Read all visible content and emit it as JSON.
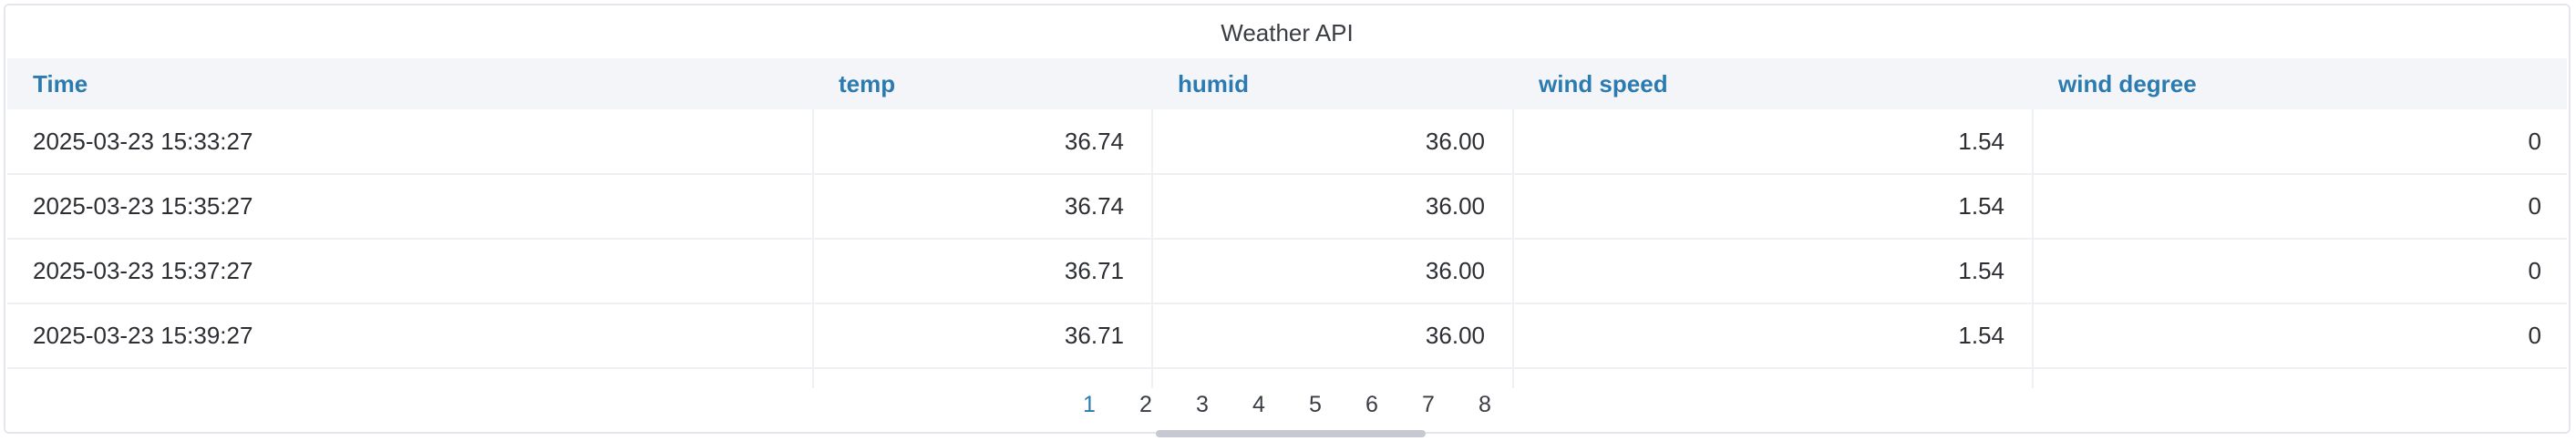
{
  "panel": {
    "title": "Weather API"
  },
  "table": {
    "columns": [
      "Time",
      "temp",
      "humid",
      "wind speed",
      "wind degree"
    ],
    "rows": [
      [
        "2025-03-23 15:33:27",
        "36.74",
        "36.00",
        "1.54",
        "0"
      ],
      [
        "2025-03-23 15:35:27",
        "36.74",
        "36.00",
        "1.54",
        "0"
      ],
      [
        "2025-03-23 15:37:27",
        "36.71",
        "36.00",
        "1.54",
        "0"
      ],
      [
        "2025-03-23 15:39:27",
        "36.71",
        "36.00",
        "1.54",
        "0"
      ],
      [
        "",
        "",
        "",
        "",
        ""
      ]
    ]
  },
  "pagination": {
    "pages": [
      "1",
      "2",
      "3",
      "4",
      "5",
      "6",
      "7",
      "8"
    ],
    "active": "1"
  },
  "colors": {
    "accent": "#2c7bb0",
    "header_bg": "#f4f5f8",
    "border": "#e3e6ee"
  }
}
